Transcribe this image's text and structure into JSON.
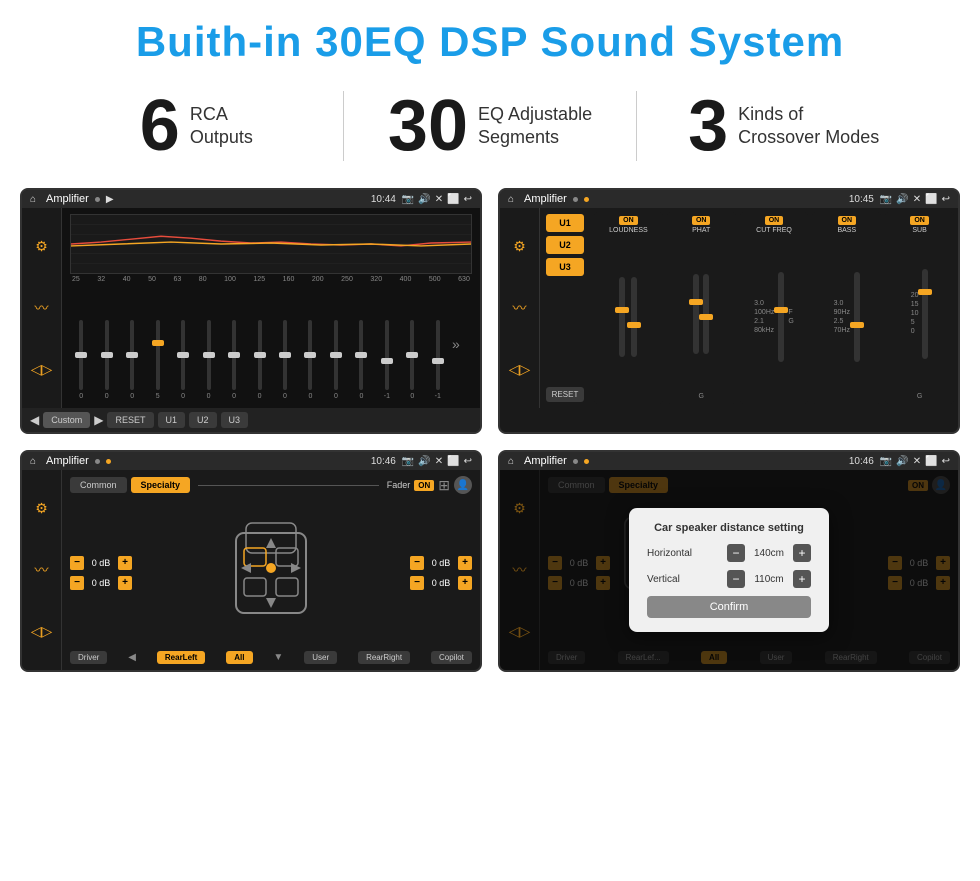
{
  "header": {
    "title": "Buith-in 30EQ DSP Sound System"
  },
  "stats": [
    {
      "number": "6",
      "label": "RCA\nOutputs"
    },
    {
      "number": "30",
      "label": "EQ Adjustable\nSegments"
    },
    {
      "number": "3",
      "label": "Kinds of\nCrossover Modes"
    }
  ],
  "screens": [
    {
      "id": "screen1",
      "title": "Amplifier",
      "time": "10:44",
      "type": "eq"
    },
    {
      "id": "screen2",
      "title": "Amplifier",
      "time": "10:45",
      "type": "bands"
    },
    {
      "id": "screen3",
      "title": "Amplifier",
      "time": "10:46",
      "type": "speaker"
    },
    {
      "id": "screen4",
      "title": "Amplifier",
      "time": "10:46",
      "type": "dialog"
    }
  ],
  "eq": {
    "frequencies": [
      "25",
      "32",
      "40",
      "50",
      "63",
      "80",
      "100",
      "125",
      "160",
      "200",
      "250",
      "320",
      "400",
      "500",
      "630"
    ],
    "values": [
      "0",
      "0",
      "0",
      "5",
      "0",
      "0",
      "0",
      "0",
      "0",
      "0",
      "0",
      "0",
      "-1",
      "0",
      "-1"
    ],
    "presets": [
      "Custom",
      "RESET",
      "U1",
      "U2",
      "U3"
    ]
  },
  "bands": {
    "items": [
      {
        "name": "LOUDNESS",
        "on": true
      },
      {
        "name": "PHAT",
        "on": true
      },
      {
        "name": "CUT FREQ",
        "on": true
      },
      {
        "name": "BASS",
        "on": true
      },
      {
        "name": "SUB",
        "on": true
      }
    ],
    "uButtons": [
      "U1",
      "U2",
      "U3"
    ],
    "resetLabel": "RESET"
  },
  "speaker": {
    "tabs": [
      "Common",
      "Specialty"
    ],
    "activeTab": "Specialty",
    "faderLabel": "Fader",
    "faderOn": "ON",
    "controls": {
      "topLeft": "0 dB",
      "bottomLeft": "0 dB",
      "topRight": "0 dB",
      "bottomRight": "0 dB"
    },
    "positions": [
      "Driver",
      "RearLeft",
      "All",
      "User",
      "RearRight",
      "Copilot"
    ]
  },
  "dialog": {
    "title": "Car speaker distance setting",
    "horizontal": {
      "label": "Horizontal",
      "value": "140cm"
    },
    "vertical": {
      "label": "Vertical",
      "value": "110cm"
    },
    "confirmLabel": "Confirm"
  }
}
